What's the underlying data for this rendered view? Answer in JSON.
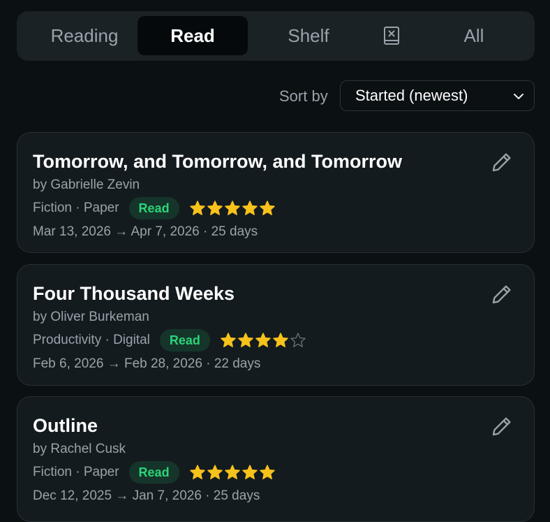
{
  "tabs": [
    {
      "label": "Reading",
      "active": false
    },
    {
      "label": "Read",
      "active": true
    },
    {
      "label": "Shelf",
      "active": false
    },
    {
      "icon": "dnf-book-x-icon",
      "active": false
    },
    {
      "label": "All",
      "active": false
    }
  ],
  "sort": {
    "label": "Sort by",
    "selected": "Started (newest)"
  },
  "books": [
    {
      "title": "Tomorrow, and Tomorrow, and Tomorrow",
      "author": "by Gabrielle Zevin",
      "meta": "Fiction · Paper",
      "status": "Read",
      "rating": 5,
      "rating_max": 5,
      "dates": "Mar 13, 2026 → Apr 7, 2026 · 25 days"
    },
    {
      "title": "Four Thousand Weeks",
      "author": "by Oliver Burkeman",
      "meta": "Productivity · Digital",
      "status": "Read",
      "rating": 4,
      "rating_max": 5,
      "dates": "Feb 6, 2026 → Feb 28, 2026 · 22 days"
    },
    {
      "title": "Outline",
      "author": "by Rachel Cusk",
      "meta": "Fiction · Paper",
      "status": "Read",
      "rating": 5,
      "rating_max": 5,
      "dates": "Dec 12, 2025 → Jan 7, 2026 · 25 days"
    }
  ],
  "colors": {
    "star_filled": "#f7c21b",
    "star_empty": "#6b757b",
    "badge_text": "#2bd47a",
    "badge_bg": "#15352a"
  }
}
